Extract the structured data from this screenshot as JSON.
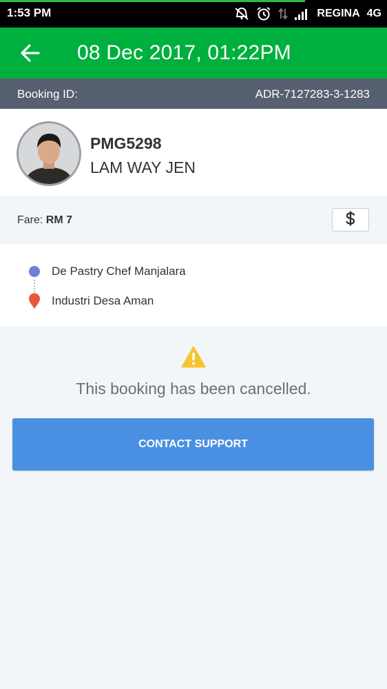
{
  "status_bar": {
    "time": "1:53 PM",
    "carrier": "REGINA",
    "network": "4G",
    "icons": [
      "mute-icon",
      "alarm-icon",
      "data-arrows-icon",
      "signal-icon"
    ]
  },
  "app_bar": {
    "title": "08 Dec 2017, 01:22PM",
    "back_icon": "arrow-left-icon",
    "color": "#00b03e"
  },
  "booking": {
    "id_label": "Booking ID:",
    "id_value": "ADR-7127283-3-1283"
  },
  "driver": {
    "plate": "PMG5298",
    "name": "LAM WAY JEN"
  },
  "fare": {
    "label": "Fare:",
    "amount": "RM 7",
    "payment_icon": "dollar-icon"
  },
  "route": {
    "pickup": "De Pastry Chef Manjalara",
    "dropoff": "Industri Desa Aman",
    "pickup_color": "#6a80d9",
    "dropoff_color": "#e8573b"
  },
  "cancellation": {
    "message": "This booking has been cancelled.",
    "warning_icon": "warning-icon",
    "button_label": "CONTACT SUPPORT",
    "button_color": "#4a90e2"
  }
}
